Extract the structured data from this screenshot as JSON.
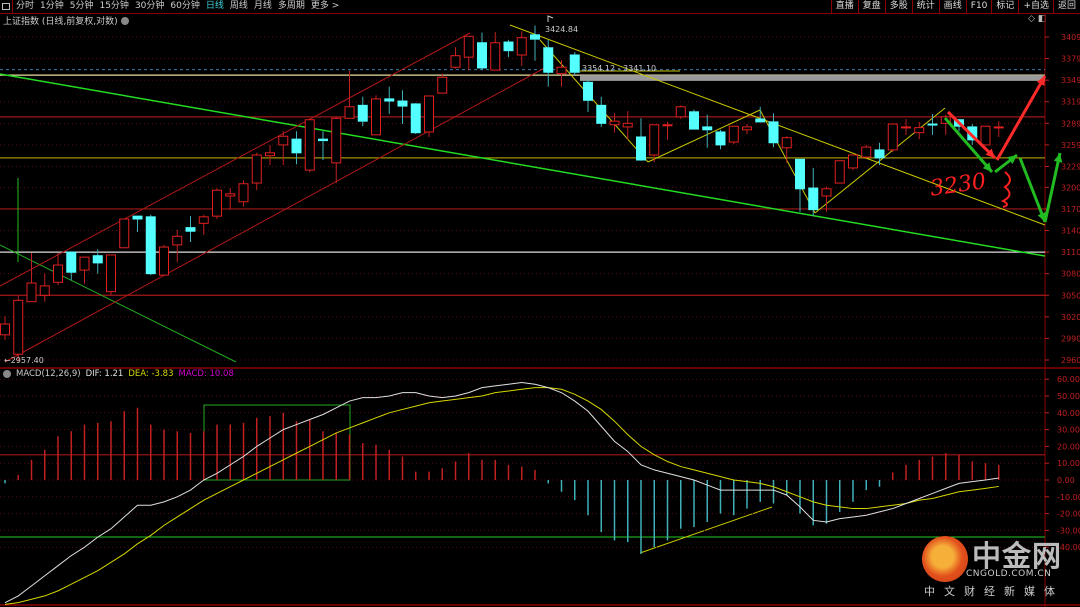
{
  "toolbar": {
    "periods": [
      "分时",
      "1分钟",
      "5分钟",
      "15分钟",
      "30分钟",
      "60分钟",
      "日线",
      "周线",
      "月线",
      "多周期",
      "更多 >"
    ],
    "active_period": "日线",
    "buttons": [
      "直播",
      "复盘",
      "多股",
      "统计",
      "画线",
      "F10",
      "标记",
      "+自选",
      "返回"
    ]
  },
  "subtitle": "上证指数 (日线,前复权,对数)",
  "macd_header": {
    "name": "MACD(12,26,9)",
    "dif": "DIF: 1.21",
    "dea": "DEA: -3.83",
    "macd": "MACD: 10.08"
  },
  "colors": {
    "up": "#e02020",
    "down": "#54ffff",
    "axis": "#c02020",
    "dif": "#e0e0e0",
    "dea": "#d6d600",
    "macd_label": "#d000d0"
  },
  "annotations": {
    "low": "←2957.40",
    "high": "3424.84",
    "zone": "3354.12 - 3341.10",
    "handwritten": "3230"
  },
  "logo": {
    "name": "中金网",
    "url": "CNGOLD.COM.CN",
    "slogan": "中文财经新媒体"
  },
  "chart_data": [
    {
      "type": "candlestick",
      "title": "上证指数 日线",
      "yticks": [
        3409,
        3379,
        3349,
        3319,
        3289,
        3259,
        3229,
        3200,
        3170,
        3140,
        3110,
        3080,
        3050,
        3020,
        2990,
        2960
      ],
      "ylim": [
        2960,
        3409
      ],
      "ohlc": [
        [
          2995,
          3010,
          3021,
          2988
        ],
        [
          2968,
          3043,
          3049,
          2957.4
        ],
        [
          3041,
          3067,
          3109,
          3041
        ],
        [
          3050,
          3063,
          3080,
          3041
        ],
        [
          3068,
          3092,
          3109,
          3064
        ],
        [
          3110,
          3082,
          3110,
          3071
        ],
        [
          3085,
          3103,
          3103,
          3066
        ],
        [
          3105,
          3095,
          3114,
          3080
        ],
        [
          3055,
          3106,
          3106,
          3050
        ],
        [
          3116,
          3156,
          3156,
          3116
        ],
        [
          3160,
          3156,
          3160,
          3138
        ],
        [
          3159,
          3080,
          3162,
          3078
        ],
        [
          3078,
          3117,
          3120,
          3078
        ],
        [
          3120,
          3132,
          3141,
          3096
        ],
        [
          3144,
          3139,
          3160,
          3124
        ],
        [
          3150,
          3159,
          3162,
          3134
        ],
        [
          3160,
          3196,
          3199,
          3156
        ],
        [
          3188,
          3191,
          3199,
          3169
        ],
        [
          3180,
          3205,
          3210,
          3173
        ],
        [
          3206,
          3245,
          3248,
          3196
        ],
        [
          3244,
          3248,
          3259,
          3231
        ],
        [
          3259,
          3271,
          3278,
          3231
        ],
        [
          3267,
          3248,
          3278,
          3232
        ],
        [
          3224,
          3294,
          3296,
          3221
        ],
        [
          3267,
          3265,
          3278,
          3238
        ],
        [
          3234,
          3296,
          3298,
          3206
        ],
        [
          3296,
          3312,
          3362,
          3296
        ],
        [
          3314,
          3292,
          3326,
          3285
        ],
        [
          3273,
          3323,
          3328,
          3273
        ],
        [
          3323,
          3320,
          3340,
          3302
        ],
        [
          3320,
          3313,
          3335,
          3288
        ],
        [
          3316,
          3276,
          3317,
          3274
        ],
        [
          3277,
          3327,
          3327,
          3270
        ],
        [
          3331,
          3353,
          3358,
          3331
        ],
        [
          3367,
          3383,
          3395,
          3365
        ],
        [
          3381,
          3410,
          3410,
          3363
        ],
        [
          3401,
          3366,
          3415,
          3363
        ],
        [
          3363,
          3401,
          3416,
          3363
        ],
        [
          3402,
          3390,
          3405,
          3381
        ],
        [
          3384,
          3408,
          3417,
          3369
        ],
        [
          3412,
          3406,
          3424.84,
          3376
        ],
        [
          3394,
          3360,
          3405,
          3340
        ],
        [
          3358,
          3367,
          3377,
          3340
        ],
        [
          3384,
          3360,
          3388,
          3356
        ],
        [
          3346,
          3321,
          3349,
          3305
        ],
        [
          3314,
          3289,
          3326,
          3284
        ],
        [
          3287,
          3292,
          3303,
          3276
        ],
        [
          3284,
          3289,
          3306,
          3266
        ],
        [
          3270,
          3238,
          3296,
          3237
        ],
        [
          3245,
          3287,
          3287,
          3235
        ],
        [
          3286,
          3287,
          3291,
          3266
        ],
        [
          3298,
          3312,
          3314,
          3295
        ],
        [
          3305,
          3281,
          3308,
          3281
        ],
        [
          3284,
          3280,
          3301,
          3255
        ],
        [
          3277,
          3259,
          3280,
          3253
        ],
        [
          3263,
          3285,
          3285,
          3260
        ],
        [
          3280,
          3284,
          3288,
          3274
        ],
        [
          3295,
          3291,
          3312,
          3291
        ],
        [
          3291,
          3262,
          3303,
          3256
        ],
        [
          3255,
          3269,
          3271,
          3234
        ],
        [
          3239,
          3198,
          3239,
          3166
        ],
        [
          3199,
          3169,
          3227,
          3160
        ],
        [
          3188,
          3198,
          3201,
          3166
        ],
        [
          3206,
          3237,
          3237,
          3206
        ],
        [
          3227,
          3245,
          3245,
          3224
        ],
        [
          3242,
          3256,
          3259,
          3241
        ],
        [
          3252,
          3241,
          3262,
          3231
        ],
        [
          3252,
          3288,
          3288,
          3249
        ],
        [
          3283,
          3284,
          3295,
          3273
        ],
        [
          3276,
          3283,
          3291,
          3267
        ],
        [
          3288,
          3287,
          3302,
          3273
        ],
        [
          3289,
          3298,
          3301,
          3273
        ],
        [
          3294,
          3285,
          3295,
          3278
        ],
        [
          3284,
          3266,
          3288,
          3259
        ],
        [
          3259,
          3285,
          3285,
          3259
        ],
        [
          3283,
          3284,
          3292,
          3270
        ]
      ],
      "levels": [
        {
          "value": 3356,
          "color": "#e8e0a0"
        },
        {
          "value": 3298,
          "color": "#a01818"
        },
        {
          "value": 3241,
          "color": "#a09000"
        },
        {
          "value": 3170,
          "color": "#a01818"
        },
        {
          "value": 3110,
          "color": "#dddddd"
        },
        {
          "value": 3050,
          "color": "#a01818"
        }
      ],
      "zone": [
        3348,
        3356
      ]
    },
    {
      "type": "bar+line",
      "title": "MACD(12,26,9)",
      "yticks": [
        60,
        50,
        40,
        30,
        20,
        10,
        0,
        -10,
        -20,
        -30,
        -40
      ],
      "ylim": [
        -70,
        65
      ],
      "macd": [
        -2,
        3,
        12,
        18,
        26,
        29,
        33,
        34,
        35,
        41,
        43,
        33,
        30,
        29,
        28,
        29,
        33,
        33,
        34,
        37,
        38,
        40,
        35,
        36,
        29,
        28,
        27,
        22,
        21,
        18,
        14,
        5,
        5,
        7,
        11,
        16,
        12,
        12,
        9,
        8,
        6,
        -2,
        -7,
        -12,
        -21,
        -31,
        -36,
        -37,
        -44,
        -40,
        -36,
        -29,
        -28,
        -25,
        -20,
        -21,
        -17,
        -13,
        -14,
        -9,
        -20,
        -27,
        -26,
        -19,
        -13,
        -6,
        -4,
        4.5,
        9,
        12,
        14,
        16,
        15,
        11,
        10,
        9,
        10.08
      ],
      "dif": [
        -73,
        -69,
        -63,
        -57,
        -51,
        -45,
        -40,
        -34,
        -29,
        -22,
        -15,
        -15,
        -13,
        -10,
        -6,
        0,
        4,
        9,
        14,
        20,
        25,
        30,
        33,
        36,
        39,
        43,
        47,
        49,
        49,
        50,
        52,
        52,
        50,
        49,
        50,
        52,
        55,
        56,
        57,
        58,
        57,
        55,
        52,
        47,
        41,
        32,
        23,
        17,
        9,
        6,
        4,
        2,
        0,
        -3,
        -6,
        -6,
        -6,
        -6,
        -6,
        -9,
        -16,
        -24,
        -25,
        -23,
        -22,
        -21,
        -19,
        -17,
        -14,
        -11,
        -8,
        -5,
        -2,
        -1,
        0,
        1.21
      ],
      "dea": [
        -74,
        -73,
        -71,
        -69,
        -66,
        -62,
        -58,
        -54,
        -49,
        -44,
        -38,
        -33,
        -27,
        -22,
        -17,
        -12,
        -8,
        -4,
        0,
        4,
        8,
        12,
        16,
        20,
        24,
        28,
        31,
        34,
        37,
        40,
        42,
        44,
        46,
        47,
        48,
        49,
        50,
        52,
        53,
        54,
        55,
        55,
        54,
        51,
        47,
        42,
        35,
        27,
        20,
        15,
        11,
        8,
        6,
        4,
        2,
        0,
        -1,
        -2,
        -4,
        -7,
        -10,
        -13,
        -15,
        -16,
        -17,
        -17,
        -16,
        -15,
        -14,
        -12,
        -11,
        -9,
        -7,
        -6,
        -5,
        -3.83
      ],
      "levels": [
        15,
        -33.5
      ]
    }
  ]
}
